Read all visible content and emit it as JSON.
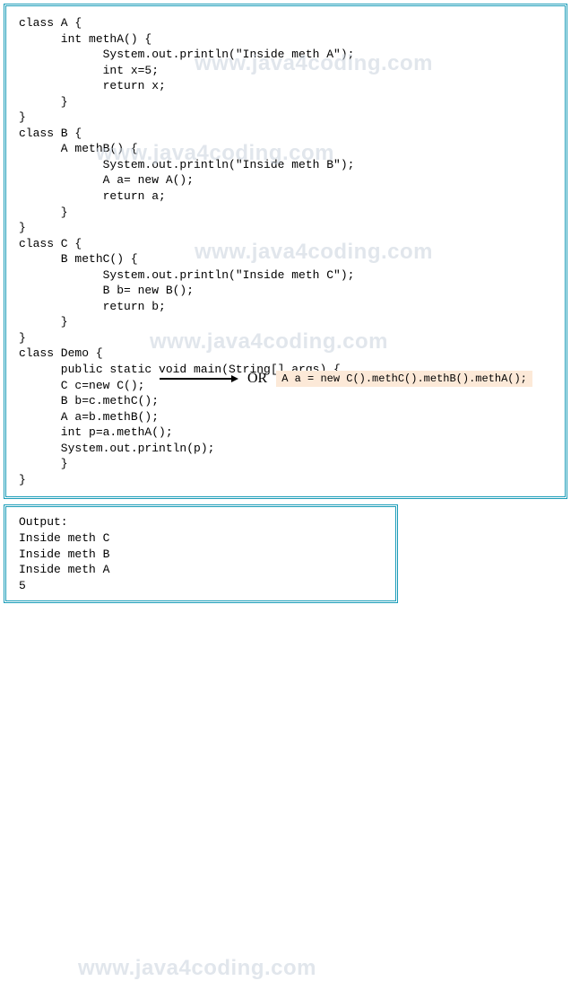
{
  "code": {
    "classA_decl": "class A {",
    "methA_decl": "      int methA() {",
    "methA_l1": "            System.out.println(\"Inside meth A\");",
    "methA_l2": "            int x=5;",
    "methA_l3": "            return x;",
    "methA_close": "      }",
    "classA_close": "}",
    "classB_decl": "class B {",
    "methB_decl": "      A methB() {",
    "methB_l1": "            System.out.println(\"Inside meth B\");",
    "methB_l2": "            A a= new A();",
    "methB_l3": "            return a;",
    "methB_close": "      }",
    "classB_close": "}",
    "classC_decl": "class C {",
    "methC_decl": "      B methC() {",
    "methC_l1": "            System.out.println(\"Inside meth C\");",
    "methC_l2": "            B b= new B();",
    "methC_l3": "            return b;",
    "methC_close": "      }",
    "classC_close": "}",
    "classDemo_decl": "class Demo {",
    "main_decl": "      public static void main(String[] args) {",
    "main_l1": "      C c=new C();",
    "main_l2": "      B b=c.methC();",
    "main_l3": "      A a=b.methB();",
    "main_l4": "      int p=a.methA();",
    "main_l5": "      System.out.println(p);",
    "main_close": "      }",
    "classDemo_close": "}"
  },
  "annotation": {
    "or_label": "OR",
    "alt_code": "A a = new C().methC().methB().methA();"
  },
  "output": {
    "label": "Output:",
    "l1": "Inside meth C",
    "l2": "Inside meth B",
    "l3": "Inside meth A",
    "l4": "5"
  },
  "watermark": "www.java4coding.com"
}
